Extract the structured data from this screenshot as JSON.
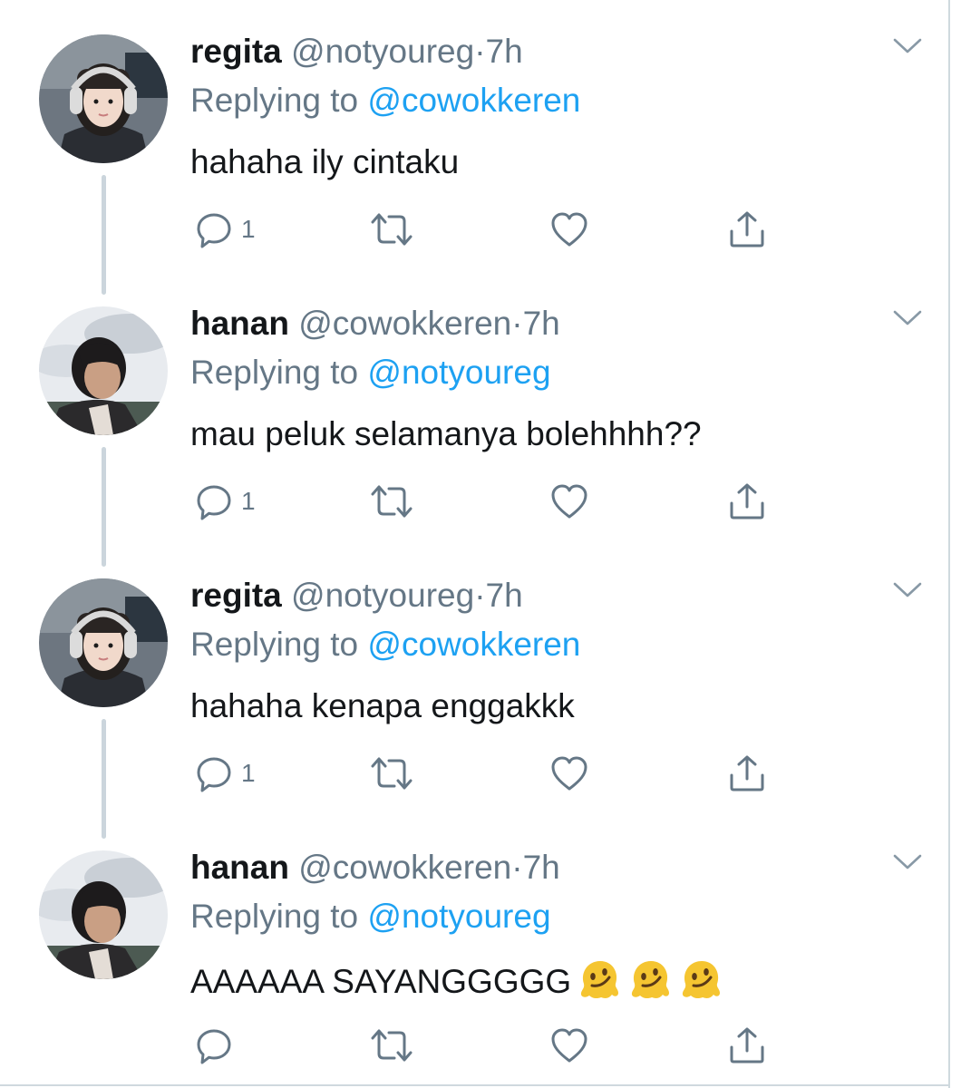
{
  "tweets": [
    {
      "name": "regita",
      "handle": "@notyoureg",
      "dot": "·",
      "time": "7h",
      "replying_prefix": "Replying to ",
      "replying_to": "@cowokkeren",
      "text": "hahaha ily cintaku",
      "reply_count": "1",
      "avatar": "girl-headphones"
    },
    {
      "name": "hanan",
      "handle": "@cowokkeren",
      "dot": "·",
      "time": "7h",
      "replying_prefix": "Replying to ",
      "replying_to": "@notyoureg",
      "text": "mau peluk selamanya bolehhhh??",
      "reply_count": "1",
      "avatar": "boy-sky"
    },
    {
      "name": "regita",
      "handle": "@notyoureg",
      "dot": "·",
      "time": "7h",
      "replying_prefix": "Replying to ",
      "replying_to": "@cowokkeren",
      "text": "hahaha kenapa enggakkk",
      "reply_count": "1",
      "avatar": "girl-headphones"
    },
    {
      "name": "hanan",
      "handle": "@cowokkeren",
      "dot": "·",
      "time": "7h",
      "replying_prefix": "Replying to ",
      "replying_to": "@notyoureg",
      "text": "AAAAAA SAYANGGGGG",
      "reply_count": "",
      "emoji": "melting-face-emoji ×3",
      "avatar": "boy-sky"
    }
  ],
  "colors": {
    "text": "#14171a",
    "secondary": "#657786",
    "link": "#1da1f2",
    "thread_line": "#cbd5dc"
  }
}
